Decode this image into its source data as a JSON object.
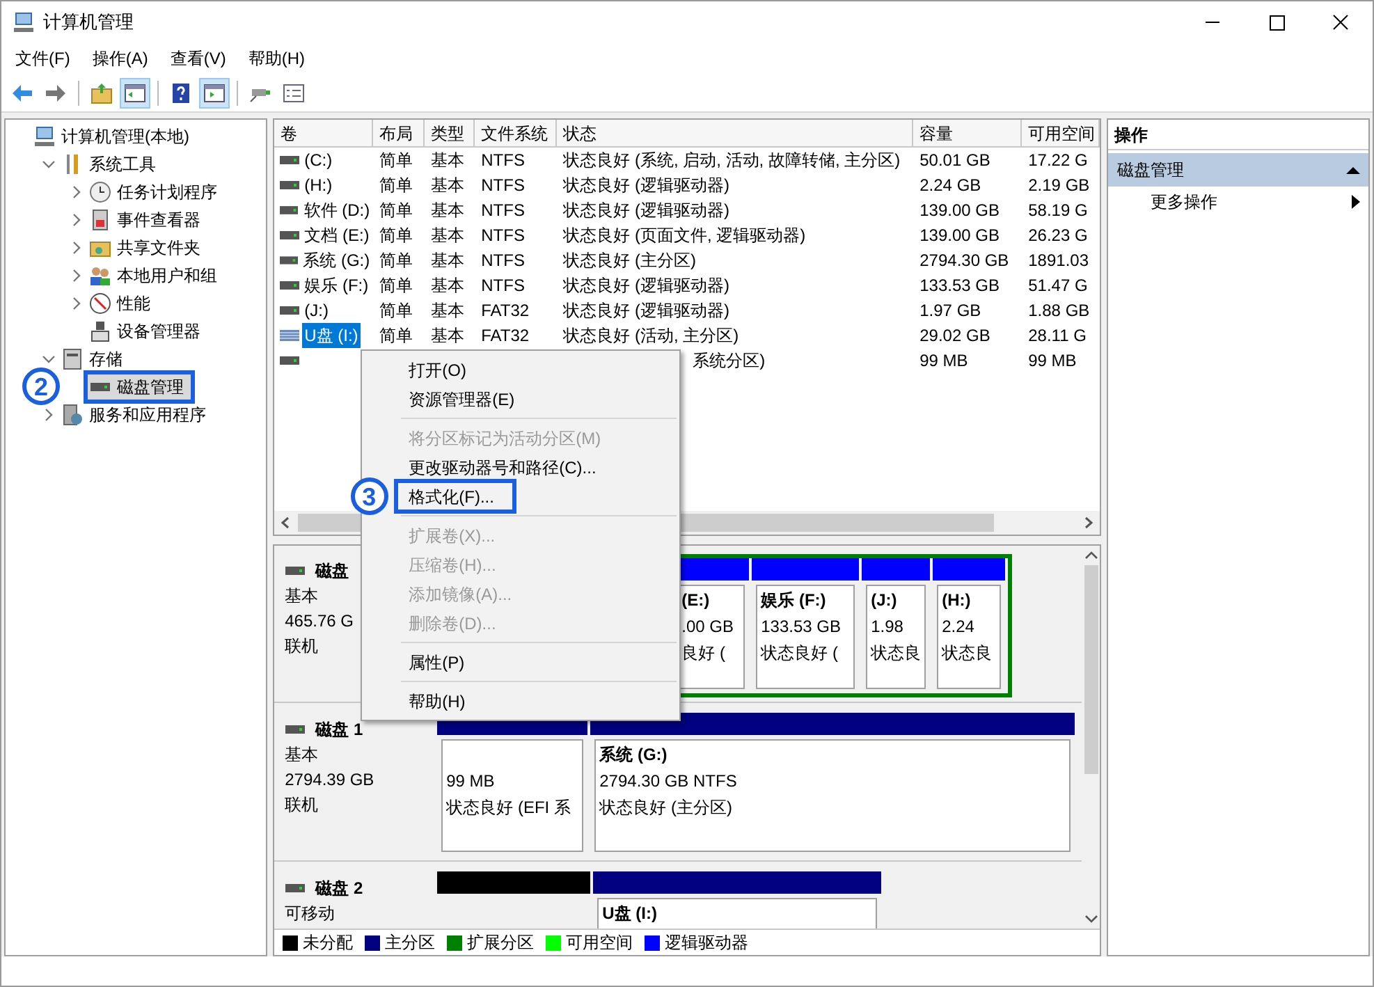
{
  "window": {
    "title": "计算机管理"
  },
  "menu": [
    "文件(F)",
    "操作(A)",
    "查看(V)",
    "帮助(H)"
  ],
  "toolbar": [
    {
      "kind": "back",
      "pressed": false
    },
    {
      "kind": "forward",
      "pressed": false
    },
    {
      "kind": "up",
      "pressed": false
    },
    {
      "kind": "tree",
      "pressed": true
    },
    {
      "kind": "help",
      "pressed": false
    },
    {
      "kind": "pane",
      "pressed": true
    },
    {
      "kind": "connect",
      "pressed": false
    },
    {
      "kind": "properties",
      "pressed": false
    }
  ],
  "tree": [
    {
      "label": "计算机管理(本地)",
      "kind": "computer",
      "selected": false,
      "children": [
        {
          "label": "系统工具",
          "kind": "tools",
          "selected": false,
          "expanded": true,
          "children": [
            {
              "label": "任务计划程序",
              "kind": "clock",
              "selected": false,
              "expanded": false
            },
            {
              "label": "事件查看器",
              "kind": "events",
              "selected": false,
              "expanded": false
            },
            {
              "label": "共享文件夹",
              "kind": "share",
              "selected": false,
              "expanded": false
            },
            {
              "label": "本地用户和组",
              "kind": "users",
              "selected": false,
              "expanded": false
            },
            {
              "label": "性能",
              "kind": "performance",
              "selected": false,
              "expanded": false
            },
            {
              "label": "设备管理器",
              "kind": "device",
              "selected": false
            }
          ]
        },
        {
          "label": "存储",
          "kind": "storage",
          "selected": false,
          "expanded": true,
          "children": [
            {
              "label": "磁盘管理",
              "kind": "disk",
              "selected": true,
              "highlighted": true,
              "callout": "2"
            }
          ]
        },
        {
          "label": "服务和应用程序",
          "kind": "services",
          "selected": false,
          "expanded": false
        }
      ]
    }
  ],
  "table": {
    "columns": [
      "卷",
      "布局",
      "类型",
      "文件系统",
      "状态",
      "容量",
      "可用空间"
    ],
    "rows": [
      {
        "kind": "fixed",
        "selected": false,
        "cells": [
          "(C:)",
          "简单",
          "基本",
          "NTFS",
          "状态良好 (系统, 启动, 活动, 故障转储, 主分区)",
          "50.01 GB",
          "17.22 G"
        ]
      },
      {
        "kind": "fixed",
        "selected": false,
        "cells": [
          "(H:)",
          "简单",
          "基本",
          "NTFS",
          "状态良好 (逻辑驱动器)",
          "2.24 GB",
          "2.19 GB"
        ]
      },
      {
        "kind": "fixed",
        "selected": false,
        "cells": [
          "软件 (D:)",
          "简单",
          "基本",
          "NTFS",
          "状态良好 (逻辑驱动器)",
          "139.00 GB",
          "58.19 G"
        ]
      },
      {
        "kind": "fixed",
        "selected": false,
        "cells": [
          "文档 (E:)",
          "简单",
          "基本",
          "NTFS",
          "状态良好 (页面文件, 逻辑驱动器)",
          "139.00 GB",
          "26.23 G"
        ]
      },
      {
        "kind": "fixed",
        "selected": false,
        "cells": [
          "系统 (G:)",
          "简单",
          "基本",
          "NTFS",
          "状态良好 (主分区)",
          "2794.30 GB",
          "1891.03"
        ]
      },
      {
        "kind": "fixed",
        "selected": false,
        "cells": [
          "娱乐 (F:)",
          "简单",
          "基本",
          "NTFS",
          "状态良好 (逻辑驱动器)",
          "133.53 GB",
          "51.47 G"
        ]
      },
      {
        "kind": "fixed",
        "selected": false,
        "cells": [
          "(J:)",
          "简单",
          "基本",
          "FAT32",
          "状态良好 (逻辑驱动器)",
          "1.97 GB",
          "1.88 GB"
        ]
      },
      {
        "kind": "removable",
        "selected": true,
        "cells": [
          "U盘 (I:)",
          "简单",
          "基本",
          "FAT32",
          "状态良好 (活动, 主分区)",
          "29.02 GB",
          "28.11 G"
        ]
      },
      {
        "kind": "fixed",
        "selected": false,
        "covered": true,
        "cells": [
          "",
          "",
          "",
          "",
          "系统分区)",
          "99 MB",
          "99 MB"
        ]
      }
    ]
  },
  "context_menu": [
    {
      "kind": "item",
      "label": "打开(O)",
      "disabled": false
    },
    {
      "kind": "item",
      "label": "资源管理器(E)",
      "disabled": false
    },
    {
      "kind": "separator"
    },
    {
      "kind": "item",
      "label": "将分区标记为活动分区(M)",
      "disabled": true
    },
    {
      "kind": "item",
      "label": "更改驱动器号和路径(C)...",
      "disabled": false
    },
    {
      "kind": "item",
      "label": "格式化(F)...",
      "disabled": false,
      "highlighted": true,
      "callout": "3"
    },
    {
      "kind": "separator"
    },
    {
      "kind": "item",
      "label": "扩展卷(X)...",
      "disabled": true
    },
    {
      "kind": "item",
      "label": "压缩卷(H)...",
      "disabled": true
    },
    {
      "kind": "item",
      "label": "添加镜像(A)...",
      "disabled": true
    },
    {
      "kind": "item",
      "label": "删除卷(D)...",
      "disabled": true
    },
    {
      "kind": "separator"
    },
    {
      "kind": "item",
      "label": "属性(P)",
      "disabled": false
    },
    {
      "kind": "separator"
    },
    {
      "kind": "item",
      "label": "帮助(H)",
      "disabled": false
    }
  ],
  "disks": [
    {
      "name": "磁盘",
      "lines": [
        "基本",
        "465.76 G",
        "联机"
      ],
      "partitions": [
        {
          "kind": "extended",
          "children": [
            {
              "label": "(E:)",
              "size": ".00 GB",
              "status": "良好 (",
              "color": "#0000ff"
            },
            {
              "label": "娱乐 (F:)",
              "size": "133.53 GB",
              "status": "状态良好 (",
              "color": "#0000ff"
            },
            {
              "label": "(J:)",
              "size": "1.98",
              "status": "状态良",
              "color": "#0000ff"
            },
            {
              "label": "(H:)",
              "size": "2.24",
              "status": "状态良",
              "color": "#0000ff"
            }
          ]
        }
      ]
    },
    {
      "name": "磁盘 1",
      "lines": [
        "基本",
        "2794.39 GB",
        "联机"
      ],
      "partitions": [
        {
          "kind": "primary",
          "size": "99 MB",
          "status": "状态良好 (EFI 系",
          "color": "#000080"
        },
        {
          "kind": "primary",
          "label": "系统 (G:)",
          "size": "2794.30 GB NTFS",
          "status": "状态良好 (主分区)",
          "color": "#000080"
        }
      ]
    },
    {
      "name": "磁盘 2",
      "lines": [
        "可移动"
      ],
      "partitions": [
        {
          "kind": "unallocated",
          "color": "#000000"
        },
        {
          "kind": "primary",
          "label": "U盘 (I:)",
          "color": "#000080"
        }
      ]
    }
  ],
  "legend": [
    {
      "label": "未分配",
      "color": "#000000"
    },
    {
      "label": "主分区",
      "color": "#000080"
    },
    {
      "label": "扩展分区",
      "color": "#008000"
    },
    {
      "label": "可用空间",
      "color": "#00ff00"
    },
    {
      "label": "逻辑驱动器",
      "color": "#0000ff"
    }
  ],
  "actions": {
    "title": "操作",
    "section": "磁盘管理",
    "expanded": true,
    "items": [
      "更多操作"
    ]
  }
}
